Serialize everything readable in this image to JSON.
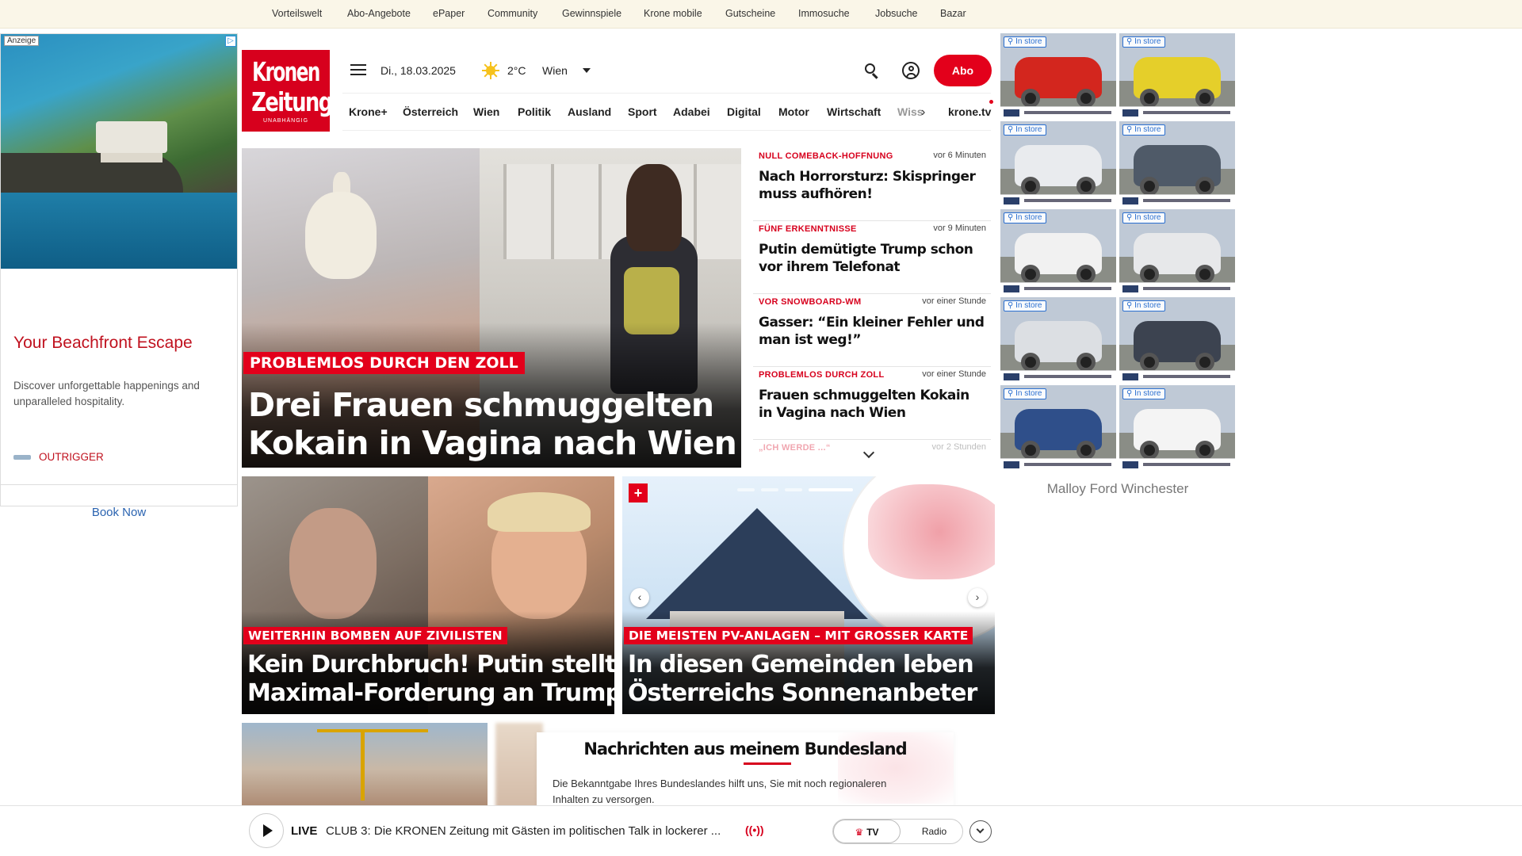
{
  "topbar": {
    "links": [
      "Vorteilswelt",
      "Abo-Angebote",
      "ePaper",
      "Community",
      "Gewinnspiele",
      "Krone mobile",
      "Gutscheine",
      "Immosuche",
      "Jobsuche",
      "Bazar"
    ]
  },
  "left_ad": {
    "badge": "Anzeige",
    "adchoice": "▷",
    "title": "Your Beachfront Escape",
    "text": "Discover unforgettable happenings and unparalleled hospitality.",
    "brand": "OUTRIGGER",
    "cta": "Book Now"
  },
  "header": {
    "logo_line1": "Kronen",
    "logo_line2": "Zeitung",
    "logo_tagline": "UNABHÄNGIG",
    "date": "Di., 18.03.2025",
    "temperature": "2°C",
    "city": "Wien",
    "abo_label": "Abo"
  },
  "nav": {
    "items": [
      "Krone+",
      "Österreich",
      "Wien",
      "Politik",
      "Ausland",
      "Sport",
      "Adabei",
      "Digital",
      "Motor",
      "Wirtschaft",
      "Wiss"
    ],
    "arrow": "›",
    "kronetv": "krone.tv"
  },
  "hero": {
    "kicker": "PROBLEMLOS DURCH DEN ZOLL",
    "headline_line1": "Drei Frauen schmuggelten",
    "headline_line2": "Kokain in Vagina nach Wien"
  },
  "newslist": [
    {
      "kicker": "NULL COMEBACK-HOFFNUNG",
      "time": "vor 6 Minuten",
      "title": "Nach Horrorsturz: Skispringer muss aufhören!"
    },
    {
      "kicker": "FÜNF ERKENNTNISSE",
      "time": "vor 9 Minuten",
      "title": "Putin demütigte Trump schon vor ihrem Telefonat"
    },
    {
      "kicker": "VOR SNOWBOARD-WM",
      "time": "vor einer Stunde",
      "title": "Gasser: “Ein kleiner Fehler und man ist weg!”"
    },
    {
      "kicker": "PROBLEMLOS DURCH ZOLL",
      "time": "vor einer Stunde",
      "title": "Frauen schmuggelten Kokain in Vagina nach Wien"
    },
    {
      "kicker": "„ICH WERDE ...“",
      "time": "vor 2 Stunden",
      "title": ""
    }
  ],
  "card1": {
    "kicker": "WEITERHIN BOMBEN AUF ZIVILISTEN",
    "headline_line1": "Kein Durchbruch! Putin stellt",
    "headline_line2": "Maximal-Forderung an Trump"
  },
  "card2": {
    "plus": "+",
    "kicker": "DIE MEISTEN PV-ANLAGEN – MIT GROSSER KARTE",
    "headline_line1": "In diesen Gemeinden leben",
    "headline_line2": "Österreichs Sonnenanbeter",
    "prev": "‹",
    "next": "›"
  },
  "bundesland": {
    "title": "Nachrichten aus meinem Bundesland",
    "text": "Die Bekanntgabe Ihres Bundeslandes hilft uns, Sie mit noch regionaleren Inhalten zu versorgen."
  },
  "livebar": {
    "live": "LIVE",
    "text": "CLUB 3: Die KRONEN Zeitung mit Gästen im politischen Talk in lockerer ...",
    "radio_icon": "((•))",
    "tv_label": "TV",
    "tv_crown": "♛",
    "radio_label": "Radio"
  },
  "right_ad": {
    "adchoice": "▷✕",
    "instore_label": "In store",
    "dealer": "Malloy Ford Winchester",
    "car_colors": [
      "#d3261e",
      "#e5cf2a",
      "#e9ebee",
      "#4f5a68",
      "#f1f1f1",
      "#e7e8ea",
      "#dcdfe3",
      "#3c4350",
      "#2f4f8a",
      "#f4f4f4"
    ]
  },
  "colors": {
    "brand_red": "#d7001d",
    "topbar_bg": "#faf6e8"
  }
}
